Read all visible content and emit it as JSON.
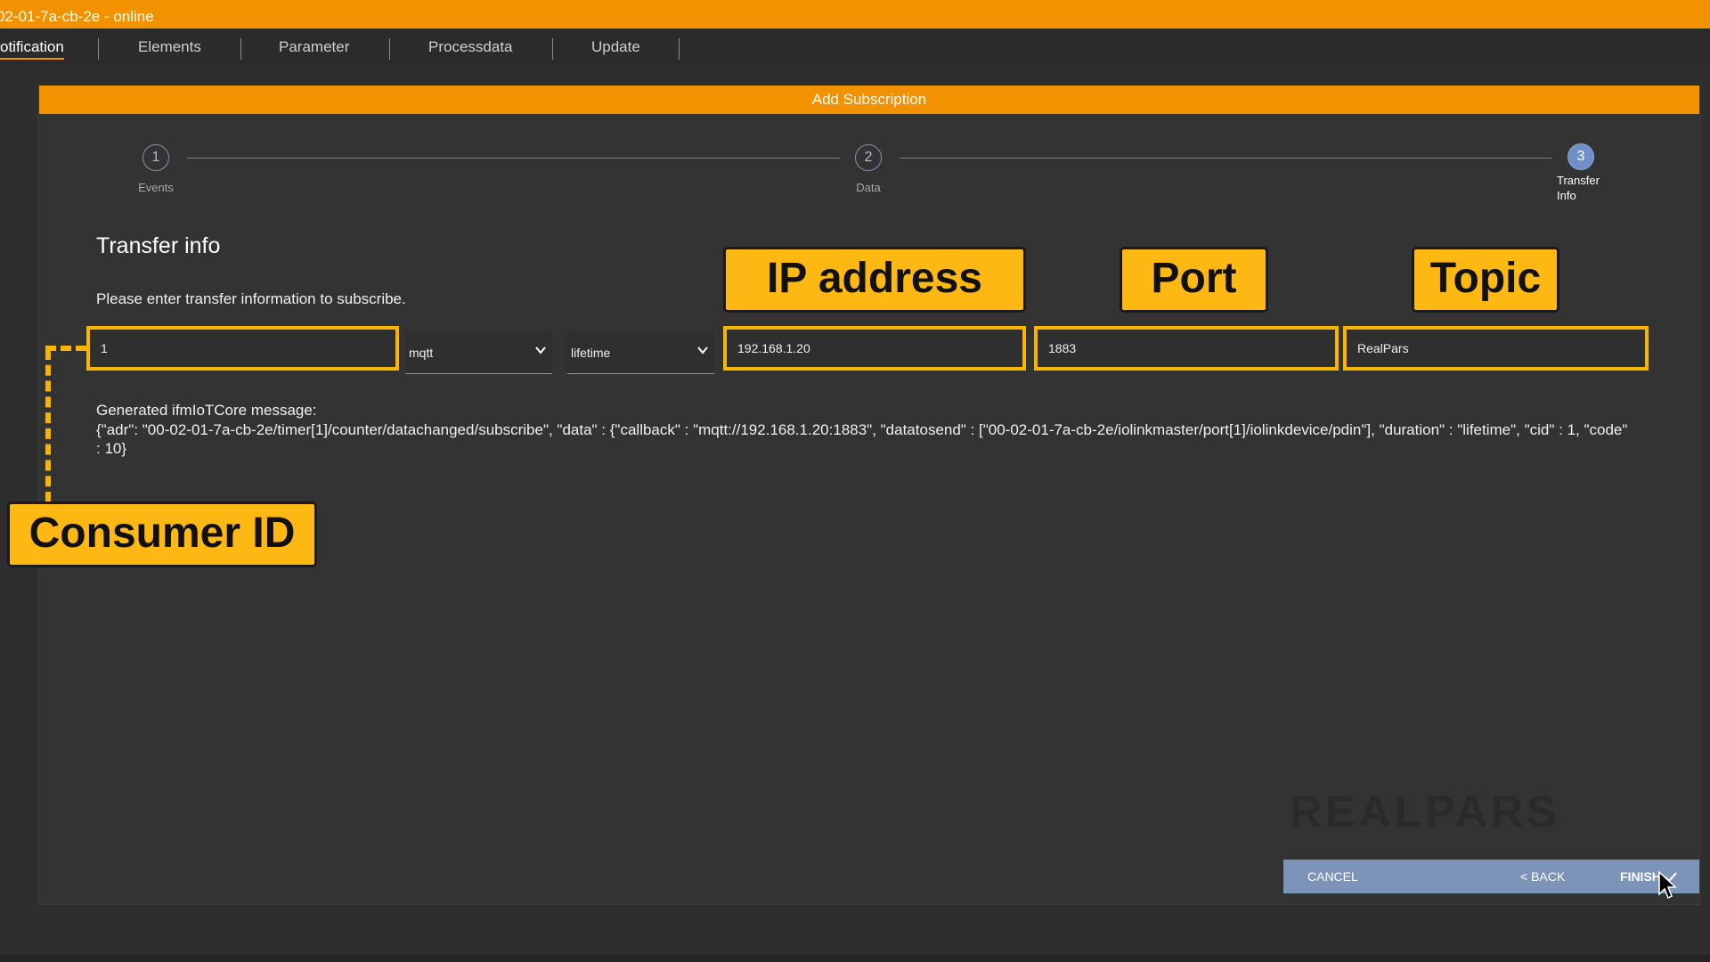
{
  "window": {
    "title": "02-01-7a-cb-2e - online"
  },
  "tabs": [
    {
      "label": "otification"
    },
    {
      "label": "Elements"
    },
    {
      "label": "Parameter"
    },
    {
      "label": "Processdata"
    },
    {
      "label": "Update"
    }
  ],
  "dialog": {
    "header": "Add Subscription",
    "steps": [
      {
        "number": "1",
        "label": "Events"
      },
      {
        "number": "2",
        "label": "Data"
      },
      {
        "number": "3",
        "label_line1": "Transfer",
        "label_line2": "Info"
      }
    ],
    "section_title": "Transfer info",
    "instruction": "Please enter transfer information to subscribe.",
    "fields": {
      "consumer_id": "1",
      "protocol": "mqtt",
      "duration": "lifetime",
      "ip_address": "192.168.1.20",
      "port": "1883",
      "topic": "RealPars"
    },
    "message_label": "Generated ifmIoTCore message:",
    "message": "{\"adr\": \"00-02-01-7a-cb-2e/timer[1]/counter/datachanged/subscribe\", \"data\" : {\"callback\" : \"mqtt://192.168.1.20:1883\", \"datatosend\" : [\"00-02-01-7a-cb-2e/iolinkmaster/port[1]/iolinkdevice/pdin\"], \"duration\" : \"lifetime\", \"cid\" : 1, \"code\" : 10}",
    "buttons": {
      "cancel": "CANCEL",
      "back": "< BACK",
      "finish": "FINISH"
    }
  },
  "callouts": {
    "ip_address": "IP address",
    "port": "Port",
    "topic": "Topic",
    "consumer_id": "Consumer ID"
  },
  "watermark": "REALPARS",
  "colors": {
    "accent": "#f39200",
    "highlight": "#fdb813",
    "footer": "#7c94b8",
    "step_active": "#6f8fc7"
  }
}
